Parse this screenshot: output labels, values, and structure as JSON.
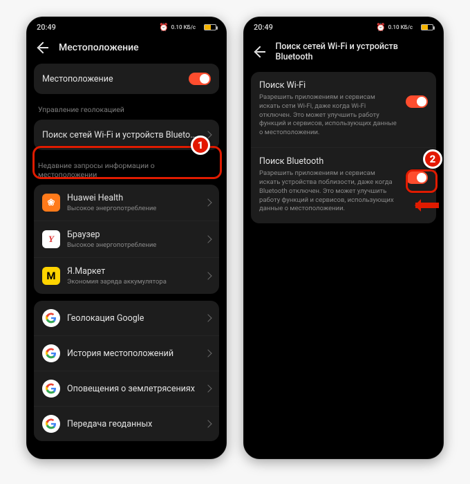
{
  "colors": {
    "accent": "#ff4d2e",
    "highlight": "#e01b00"
  },
  "status": {
    "time": "20:49",
    "net_label": "0.10 КБ/с"
  },
  "screen1": {
    "title": "Местоположение",
    "master": {
      "label": "Местоположение",
      "on": true
    },
    "section_manage": "Управление геолокацией",
    "scan_row": "Поиск сетей Wi-Fi и устройств Bluetooth",
    "section_recent": "Недавние запросы информации о местоположении",
    "recent": [
      {
        "name": "Huawei Health",
        "sub": "Высокое энергопотребление",
        "icon": "huawei"
      },
      {
        "name": "Браузер",
        "sub": "Высокое энергопотребление",
        "icon": "yandex"
      },
      {
        "name": "Я.Маркет",
        "sub": "Экономия заряда аккумулятора",
        "icon": "market"
      }
    ],
    "google": [
      "Геолокация Google",
      "История местоположений",
      "Оповещения о землетрясениях",
      "Передача геоданных"
    ]
  },
  "screen2": {
    "title": "Поиск сетей Wi-Fi и устройств Bluetooth",
    "items": [
      {
        "title": "Поиск Wi-Fi",
        "desc": "Разрешить приложениям и сервисам искать сети Wi-Fi, даже когда Wi-Fi отключен. Это может улучшить работу функций и сервисов, использующих данные о местоположении.",
        "on": true
      },
      {
        "title": "Поиск Bluetooth",
        "desc": "Разрешить приложениям и сервисам искать устройства поблизости, даже когда Bluetooth отключен. Это может улучшить работу функций и сервисов, использующих данные о местоположении.",
        "on": true
      }
    ]
  },
  "callouts": {
    "one": "1",
    "two": "2"
  }
}
